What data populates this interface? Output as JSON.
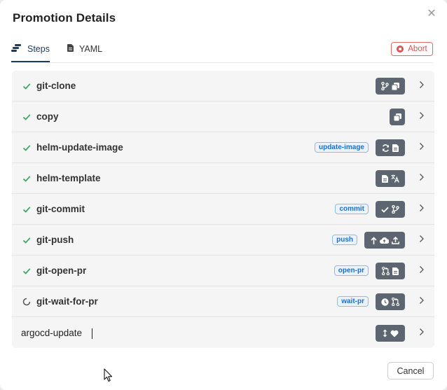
{
  "dialog": {
    "title": "Promotion Details",
    "cancel_label": "Cancel",
    "abort_label": "Abort"
  },
  "tabs": [
    {
      "label": "Steps",
      "icon": "steps-icon",
      "active": true
    },
    {
      "label": "YAML",
      "icon": "file-icon",
      "active": false
    }
  ],
  "steps": [
    {
      "name": "git-clone",
      "status": "done",
      "tag": "",
      "icons": [
        "git-branch-icon",
        "copy-icon"
      ]
    },
    {
      "name": "copy",
      "status": "done",
      "tag": "",
      "icons": [
        "copy-icon"
      ]
    },
    {
      "name": "helm-update-image",
      "status": "done",
      "tag": "update-image",
      "icons": [
        "refresh-icon",
        "file-icon"
      ]
    },
    {
      "name": "helm-template",
      "status": "done",
      "tag": "",
      "icons": [
        "file-icon",
        "translate-icon"
      ]
    },
    {
      "name": "git-commit",
      "status": "done",
      "tag": "commit",
      "icons": [
        "check-icon",
        "git-branch-icon"
      ]
    },
    {
      "name": "git-push",
      "status": "done",
      "tag": "push",
      "icons": [
        "arrow-up-icon",
        "cloud-upload-icon",
        "upload-icon"
      ]
    },
    {
      "name": "git-open-pr",
      "status": "done",
      "tag": "open-pr",
      "icons": [
        "pull-request-icon",
        "file-icon"
      ]
    },
    {
      "name": "git-wait-for-pr",
      "status": "running",
      "tag": "wait-pr",
      "icons": [
        "clock-icon",
        "pull-request-icon"
      ]
    },
    {
      "name": "argocd-update",
      "status": "pending",
      "tag": "",
      "icons": [
        "arrows-vertical-icon",
        "heart-icon"
      ]
    }
  ],
  "colors": {
    "accent": "#1f3a5c",
    "success": "#3aa65b",
    "danger": "#e0504f",
    "tag_text": "#1e6fc5",
    "icon_box": "#5d6670"
  }
}
